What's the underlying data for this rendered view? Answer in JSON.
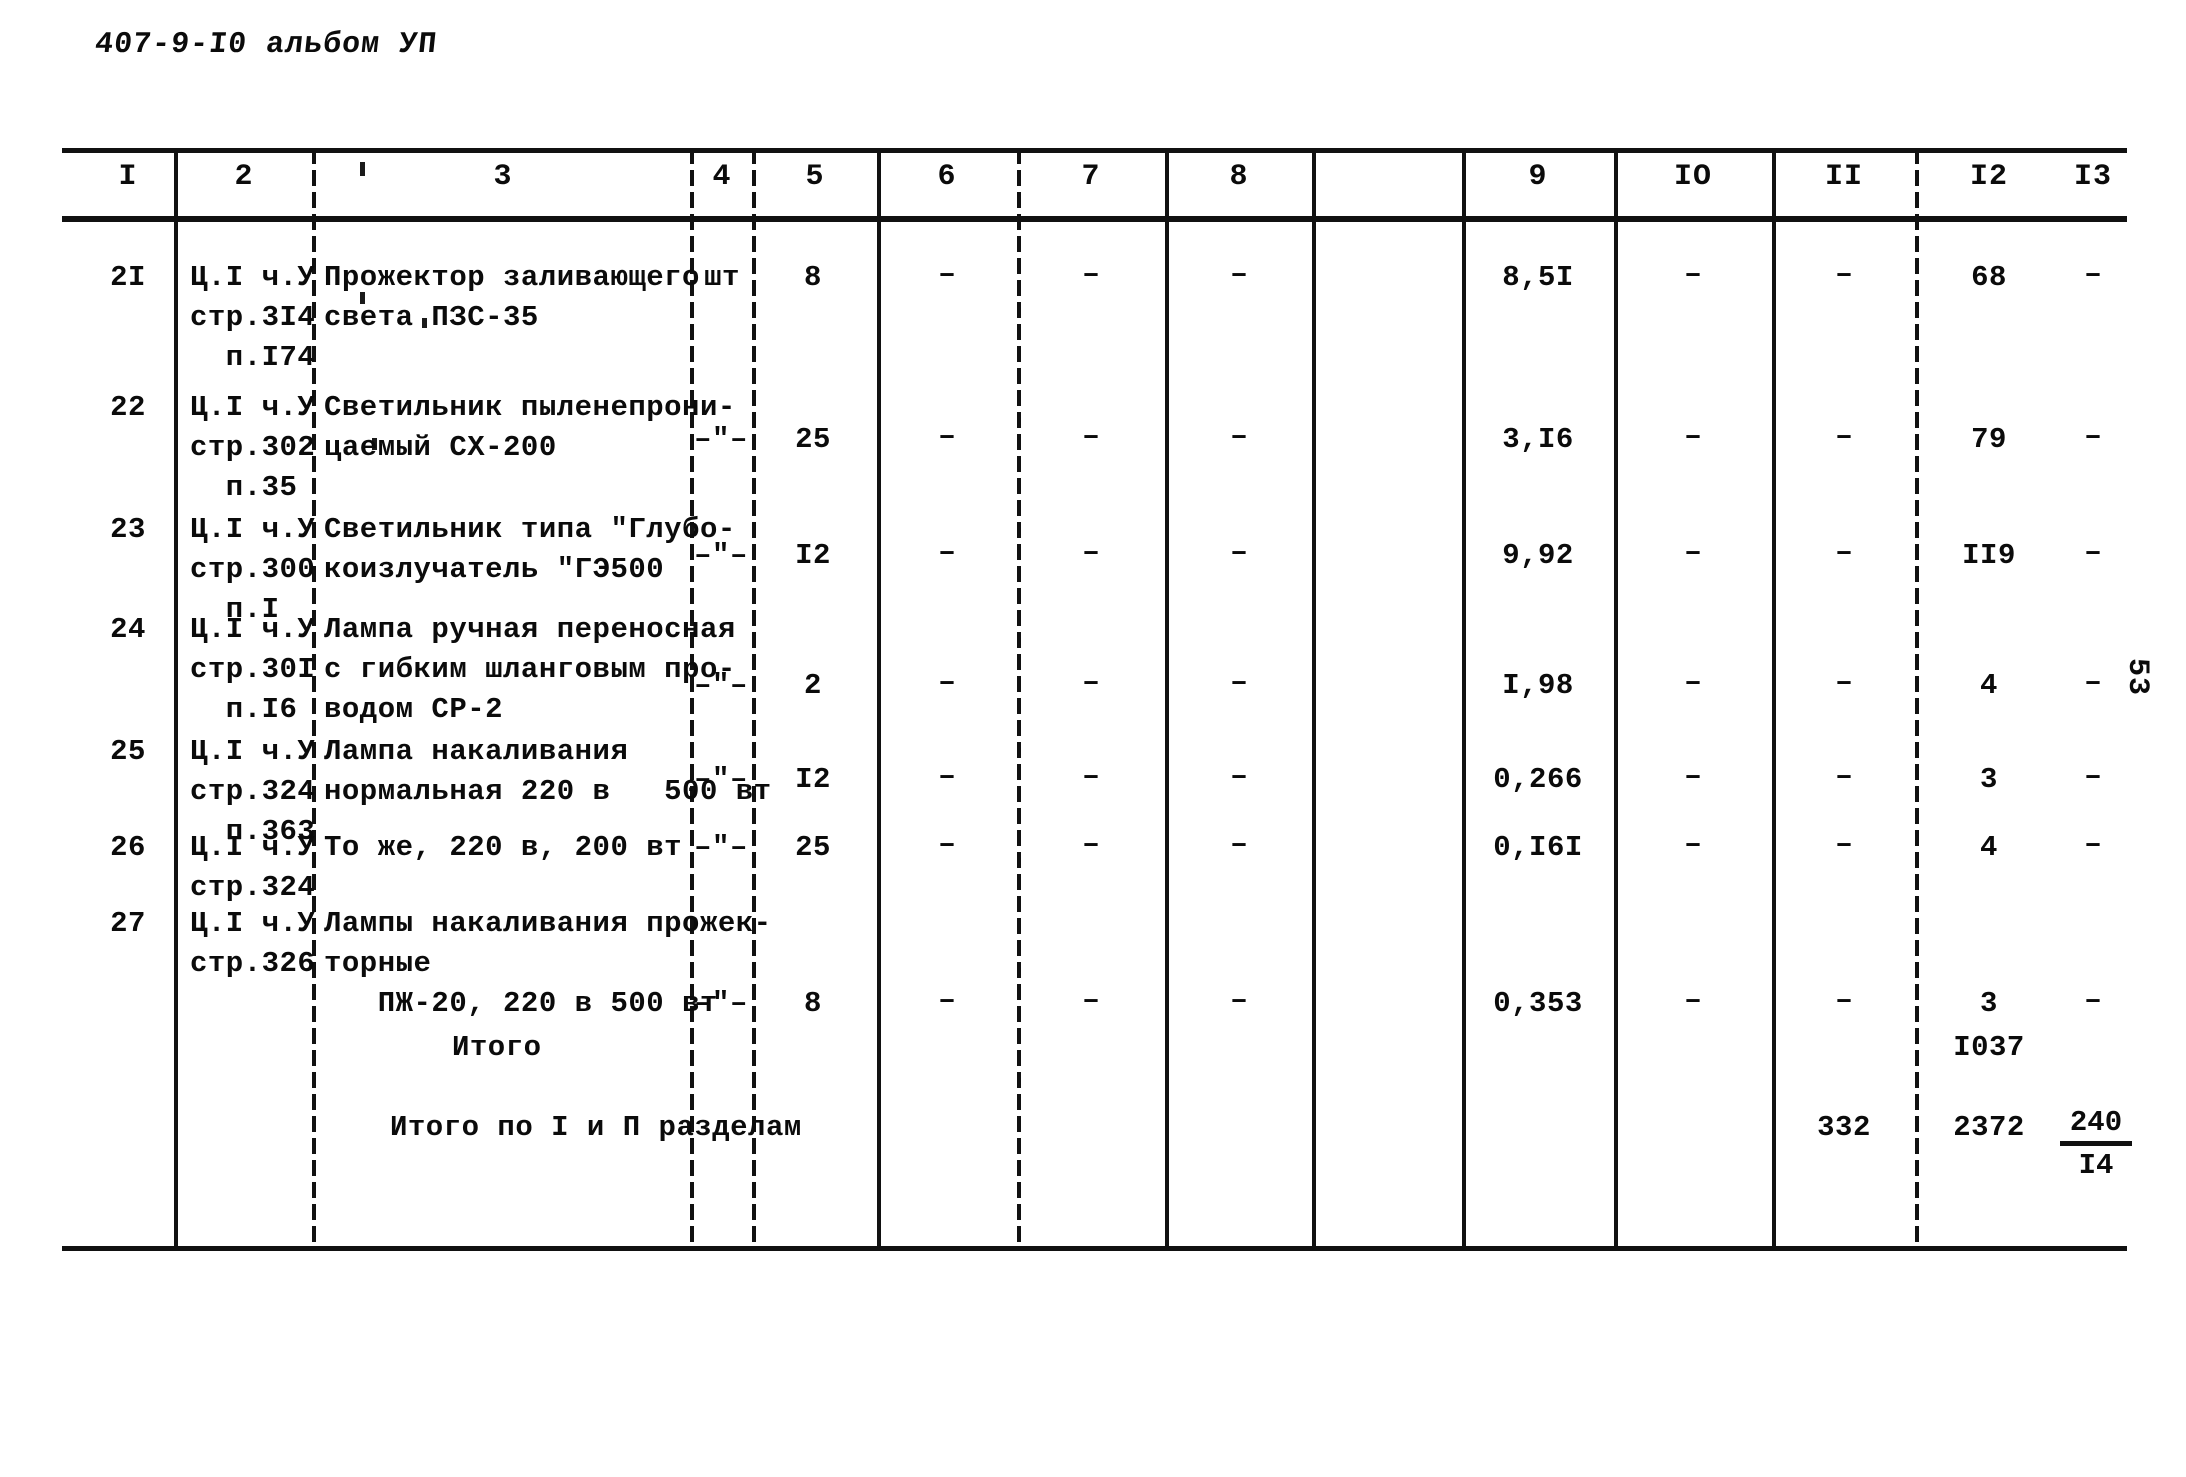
{
  "document": {
    "header_code": "407-9-I0 альбом УП",
    "side_page_number": "53"
  },
  "table": {
    "column_headers": [
      "I",
      "2",
      "3",
      "4",
      "5",
      "6",
      "7",
      "8",
      "9",
      "IO",
      "II",
      "I2",
      "I3"
    ],
    "rows": [
      {
        "c1": "2I",
        "c2": "Ц.I ч.У\nстр.3I4\n  п.I74",
        "c3": "Прожектор заливающего\nсвета ПЗС-35",
        "c4": "шт",
        "c5": "8",
        "c6": "–",
        "c7": "–",
        "c8": "–",
        "c9": "8,5I",
        "c10": "–",
        "c11": "–",
        "c12": "68",
        "c13": "–"
      },
      {
        "c1": "22",
        "c2": "Ц.I ч.У\nстр.302\n  п.35",
        "c3": "Светильник пыленепрони-\nцаемый СХ-200",
        "c4": "–\"–",
        "c5": "25",
        "c6": "–",
        "c7": "–",
        "c8": "–",
        "c9": "3,I6",
        "c10": "–",
        "c11": "–",
        "c12": "79",
        "c13": "–"
      },
      {
        "c1": "23",
        "c2": "Ц.I ч.У\nстр.300\n  п.I",
        "c3": "Светильник типа \"Глубо-\nкоизлучатель \"ГЭ500",
        "c4": "–\"–",
        "c5": "I2",
        "c6": "–",
        "c7": "–",
        "c8": "–",
        "c9": "9,92",
        "c10": "–",
        "c11": "–",
        "c12": "II9",
        "c13": "–"
      },
      {
        "c1": "24",
        "c2": "Ц.I ч.У\nстр.30I\n  п.I6",
        "c3": "Лампа ручная переносная\nс гибким шланговым про-\nводом СР-2",
        "c4": "–\"–",
        "c5": "2",
        "c6": "–",
        "c7": "–",
        "c8": "–",
        "c9": "I,98",
        "c10": "–",
        "c11": "–",
        "c12": "4",
        "c13": "–"
      },
      {
        "c1": "25",
        "c2": "Ц.I ч.У\nстр.324\n  п.363",
        "c3": "Лампа накаливания\nнормальная 220 в   500 вт",
        "c4": "–\"–",
        "c5": "I2",
        "c6": "–",
        "c7": "–",
        "c8": "–",
        "c9": "0,266",
        "c10": "–",
        "c11": "–",
        "c12": "3",
        "c13": "–"
      },
      {
        "c1": "26",
        "c2": "Ц.I ч.У\nстр.324",
        "c3": "То же, 220 в, 200 вт",
        "c4": "–\"–",
        "c5": "25",
        "c6": "–",
        "c7": "–",
        "c8": "–",
        "c9": "0,I6I",
        "c10": "–",
        "c11": "–",
        "c12": "4",
        "c13": "–"
      },
      {
        "c1": "27",
        "c2": "Ц.I ч.У\nстр.326",
        "c3": "Лампы накаливания прожек-\nторные\n   ПЖ-20, 220 в 500 вт",
        "c4": "–\"–",
        "c5": "8",
        "c6": "–",
        "c7": "–",
        "c8": "–",
        "c9": "0,353",
        "c10": "–",
        "c11": "–",
        "c12": "3",
        "c13": "–"
      }
    ],
    "totals": [
      {
        "label": "Итого",
        "c12": "I037"
      },
      {
        "label": "Итого по I и П разделам",
        "c11": "332",
        "c12": "2372",
        "c13_top": "240",
        "c13_bottom": "I4"
      }
    ]
  }
}
